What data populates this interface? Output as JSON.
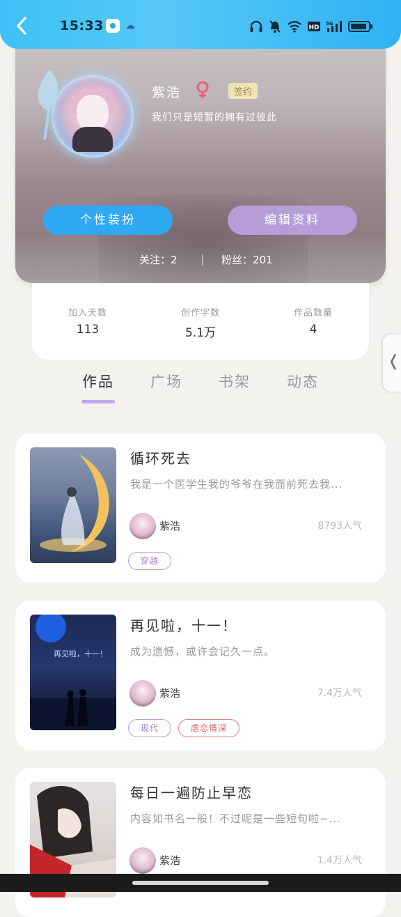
{
  "status_bar": {
    "time": "15:33"
  },
  "profile": {
    "name": "紫浩",
    "gender_symbol": "♀",
    "sign_badge": "签约",
    "bio": "我们只是短暂的拥有过彼此",
    "buttons": {
      "style_label": "个性装扮",
      "edit_label": "编辑资料"
    },
    "following_text": "关注：2",
    "fans_text": "粉丝：201"
  },
  "stats": [
    {
      "label": "加入天数",
      "value": "113"
    },
    {
      "label": "创作字数",
      "value": "5.1万"
    },
    {
      "label": "作品数量",
      "value": "4"
    }
  ],
  "tabs": [
    {
      "label": "作品",
      "active": true
    },
    {
      "label": "广场",
      "active": false
    },
    {
      "label": "书架",
      "active": false
    },
    {
      "label": "动态",
      "active": false
    }
  ],
  "works": [
    {
      "title": "循环死去",
      "description": "我是一个医学生我的爷爷在我面前死去我...",
      "author": "紫浩",
      "popularity": "8793人气",
      "tags": [
        {
          "label": "穿越",
          "color": "purple"
        }
      ]
    },
    {
      "title": "再见啦，十一！",
      "description": "成为遗憾，或许会记久一点。",
      "cover_text": "再见啦，十一！",
      "author": "紫浩",
      "popularity": "7.4万人气",
      "tags": [
        {
          "label": "现代",
          "color": "purple"
        },
        {
          "label": "虐恋情深",
          "color": "red"
        }
      ]
    },
    {
      "title": "每日一遍防止早恋",
      "description": "内容如书名一般！不过呢是一些短句啦~...",
      "author": "紫浩",
      "popularity": "1.4万人气",
      "tags": []
    }
  ],
  "colors": {
    "accent_blue": "#30a9f3",
    "accent_purple": "#b59ed8",
    "tab_underline": "#c4a7ea"
  }
}
